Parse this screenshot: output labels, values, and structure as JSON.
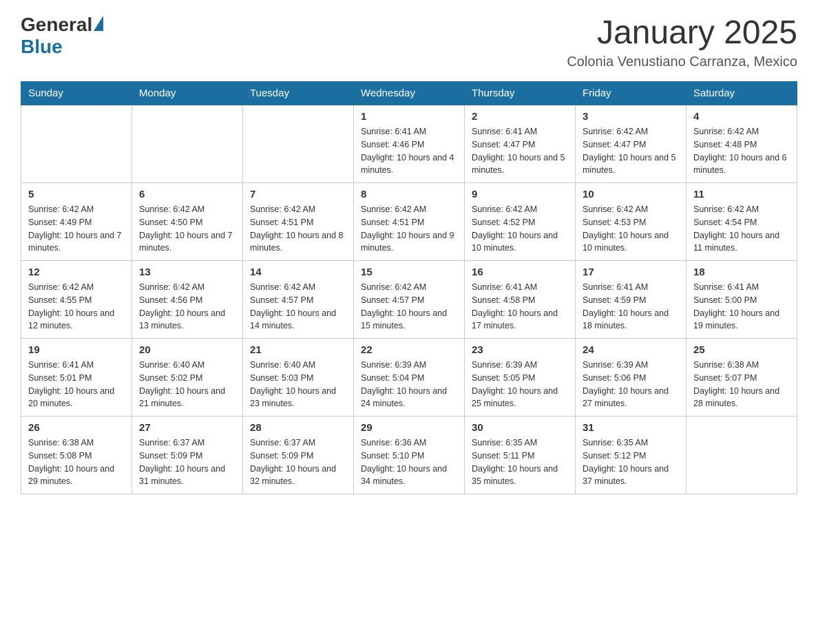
{
  "header": {
    "logo": {
      "general": "General",
      "blue": "Blue"
    },
    "title": "January 2025",
    "subtitle": "Colonia Venustiano Carranza, Mexico"
  },
  "days_of_week": [
    "Sunday",
    "Monday",
    "Tuesday",
    "Wednesday",
    "Thursday",
    "Friday",
    "Saturday"
  ],
  "weeks": [
    {
      "days": [
        {
          "num": "",
          "info": ""
        },
        {
          "num": "",
          "info": ""
        },
        {
          "num": "",
          "info": ""
        },
        {
          "num": "1",
          "info": "Sunrise: 6:41 AM\nSunset: 4:46 PM\nDaylight: 10 hours and 4 minutes."
        },
        {
          "num": "2",
          "info": "Sunrise: 6:41 AM\nSunset: 4:47 PM\nDaylight: 10 hours and 5 minutes."
        },
        {
          "num": "3",
          "info": "Sunrise: 6:42 AM\nSunset: 4:47 PM\nDaylight: 10 hours and 5 minutes."
        },
        {
          "num": "4",
          "info": "Sunrise: 6:42 AM\nSunset: 4:48 PM\nDaylight: 10 hours and 6 minutes."
        }
      ]
    },
    {
      "days": [
        {
          "num": "5",
          "info": "Sunrise: 6:42 AM\nSunset: 4:49 PM\nDaylight: 10 hours and 7 minutes."
        },
        {
          "num": "6",
          "info": "Sunrise: 6:42 AM\nSunset: 4:50 PM\nDaylight: 10 hours and 7 minutes."
        },
        {
          "num": "7",
          "info": "Sunrise: 6:42 AM\nSunset: 4:51 PM\nDaylight: 10 hours and 8 minutes."
        },
        {
          "num": "8",
          "info": "Sunrise: 6:42 AM\nSunset: 4:51 PM\nDaylight: 10 hours and 9 minutes."
        },
        {
          "num": "9",
          "info": "Sunrise: 6:42 AM\nSunset: 4:52 PM\nDaylight: 10 hours and 10 minutes."
        },
        {
          "num": "10",
          "info": "Sunrise: 6:42 AM\nSunset: 4:53 PM\nDaylight: 10 hours and 10 minutes."
        },
        {
          "num": "11",
          "info": "Sunrise: 6:42 AM\nSunset: 4:54 PM\nDaylight: 10 hours and 11 minutes."
        }
      ]
    },
    {
      "days": [
        {
          "num": "12",
          "info": "Sunrise: 6:42 AM\nSunset: 4:55 PM\nDaylight: 10 hours and 12 minutes."
        },
        {
          "num": "13",
          "info": "Sunrise: 6:42 AM\nSunset: 4:56 PM\nDaylight: 10 hours and 13 minutes."
        },
        {
          "num": "14",
          "info": "Sunrise: 6:42 AM\nSunset: 4:57 PM\nDaylight: 10 hours and 14 minutes."
        },
        {
          "num": "15",
          "info": "Sunrise: 6:42 AM\nSunset: 4:57 PM\nDaylight: 10 hours and 15 minutes."
        },
        {
          "num": "16",
          "info": "Sunrise: 6:41 AM\nSunset: 4:58 PM\nDaylight: 10 hours and 17 minutes."
        },
        {
          "num": "17",
          "info": "Sunrise: 6:41 AM\nSunset: 4:59 PM\nDaylight: 10 hours and 18 minutes."
        },
        {
          "num": "18",
          "info": "Sunrise: 6:41 AM\nSunset: 5:00 PM\nDaylight: 10 hours and 19 minutes."
        }
      ]
    },
    {
      "days": [
        {
          "num": "19",
          "info": "Sunrise: 6:41 AM\nSunset: 5:01 PM\nDaylight: 10 hours and 20 minutes."
        },
        {
          "num": "20",
          "info": "Sunrise: 6:40 AM\nSunset: 5:02 PM\nDaylight: 10 hours and 21 minutes."
        },
        {
          "num": "21",
          "info": "Sunrise: 6:40 AM\nSunset: 5:03 PM\nDaylight: 10 hours and 23 minutes."
        },
        {
          "num": "22",
          "info": "Sunrise: 6:39 AM\nSunset: 5:04 PM\nDaylight: 10 hours and 24 minutes."
        },
        {
          "num": "23",
          "info": "Sunrise: 6:39 AM\nSunset: 5:05 PM\nDaylight: 10 hours and 25 minutes."
        },
        {
          "num": "24",
          "info": "Sunrise: 6:39 AM\nSunset: 5:06 PM\nDaylight: 10 hours and 27 minutes."
        },
        {
          "num": "25",
          "info": "Sunrise: 6:38 AM\nSunset: 5:07 PM\nDaylight: 10 hours and 28 minutes."
        }
      ]
    },
    {
      "days": [
        {
          "num": "26",
          "info": "Sunrise: 6:38 AM\nSunset: 5:08 PM\nDaylight: 10 hours and 29 minutes."
        },
        {
          "num": "27",
          "info": "Sunrise: 6:37 AM\nSunset: 5:09 PM\nDaylight: 10 hours and 31 minutes."
        },
        {
          "num": "28",
          "info": "Sunrise: 6:37 AM\nSunset: 5:09 PM\nDaylight: 10 hours and 32 minutes."
        },
        {
          "num": "29",
          "info": "Sunrise: 6:36 AM\nSunset: 5:10 PM\nDaylight: 10 hours and 34 minutes."
        },
        {
          "num": "30",
          "info": "Sunrise: 6:35 AM\nSunset: 5:11 PM\nDaylight: 10 hours and 35 minutes."
        },
        {
          "num": "31",
          "info": "Sunrise: 6:35 AM\nSunset: 5:12 PM\nDaylight: 10 hours and 37 minutes."
        },
        {
          "num": "",
          "info": ""
        }
      ]
    }
  ]
}
